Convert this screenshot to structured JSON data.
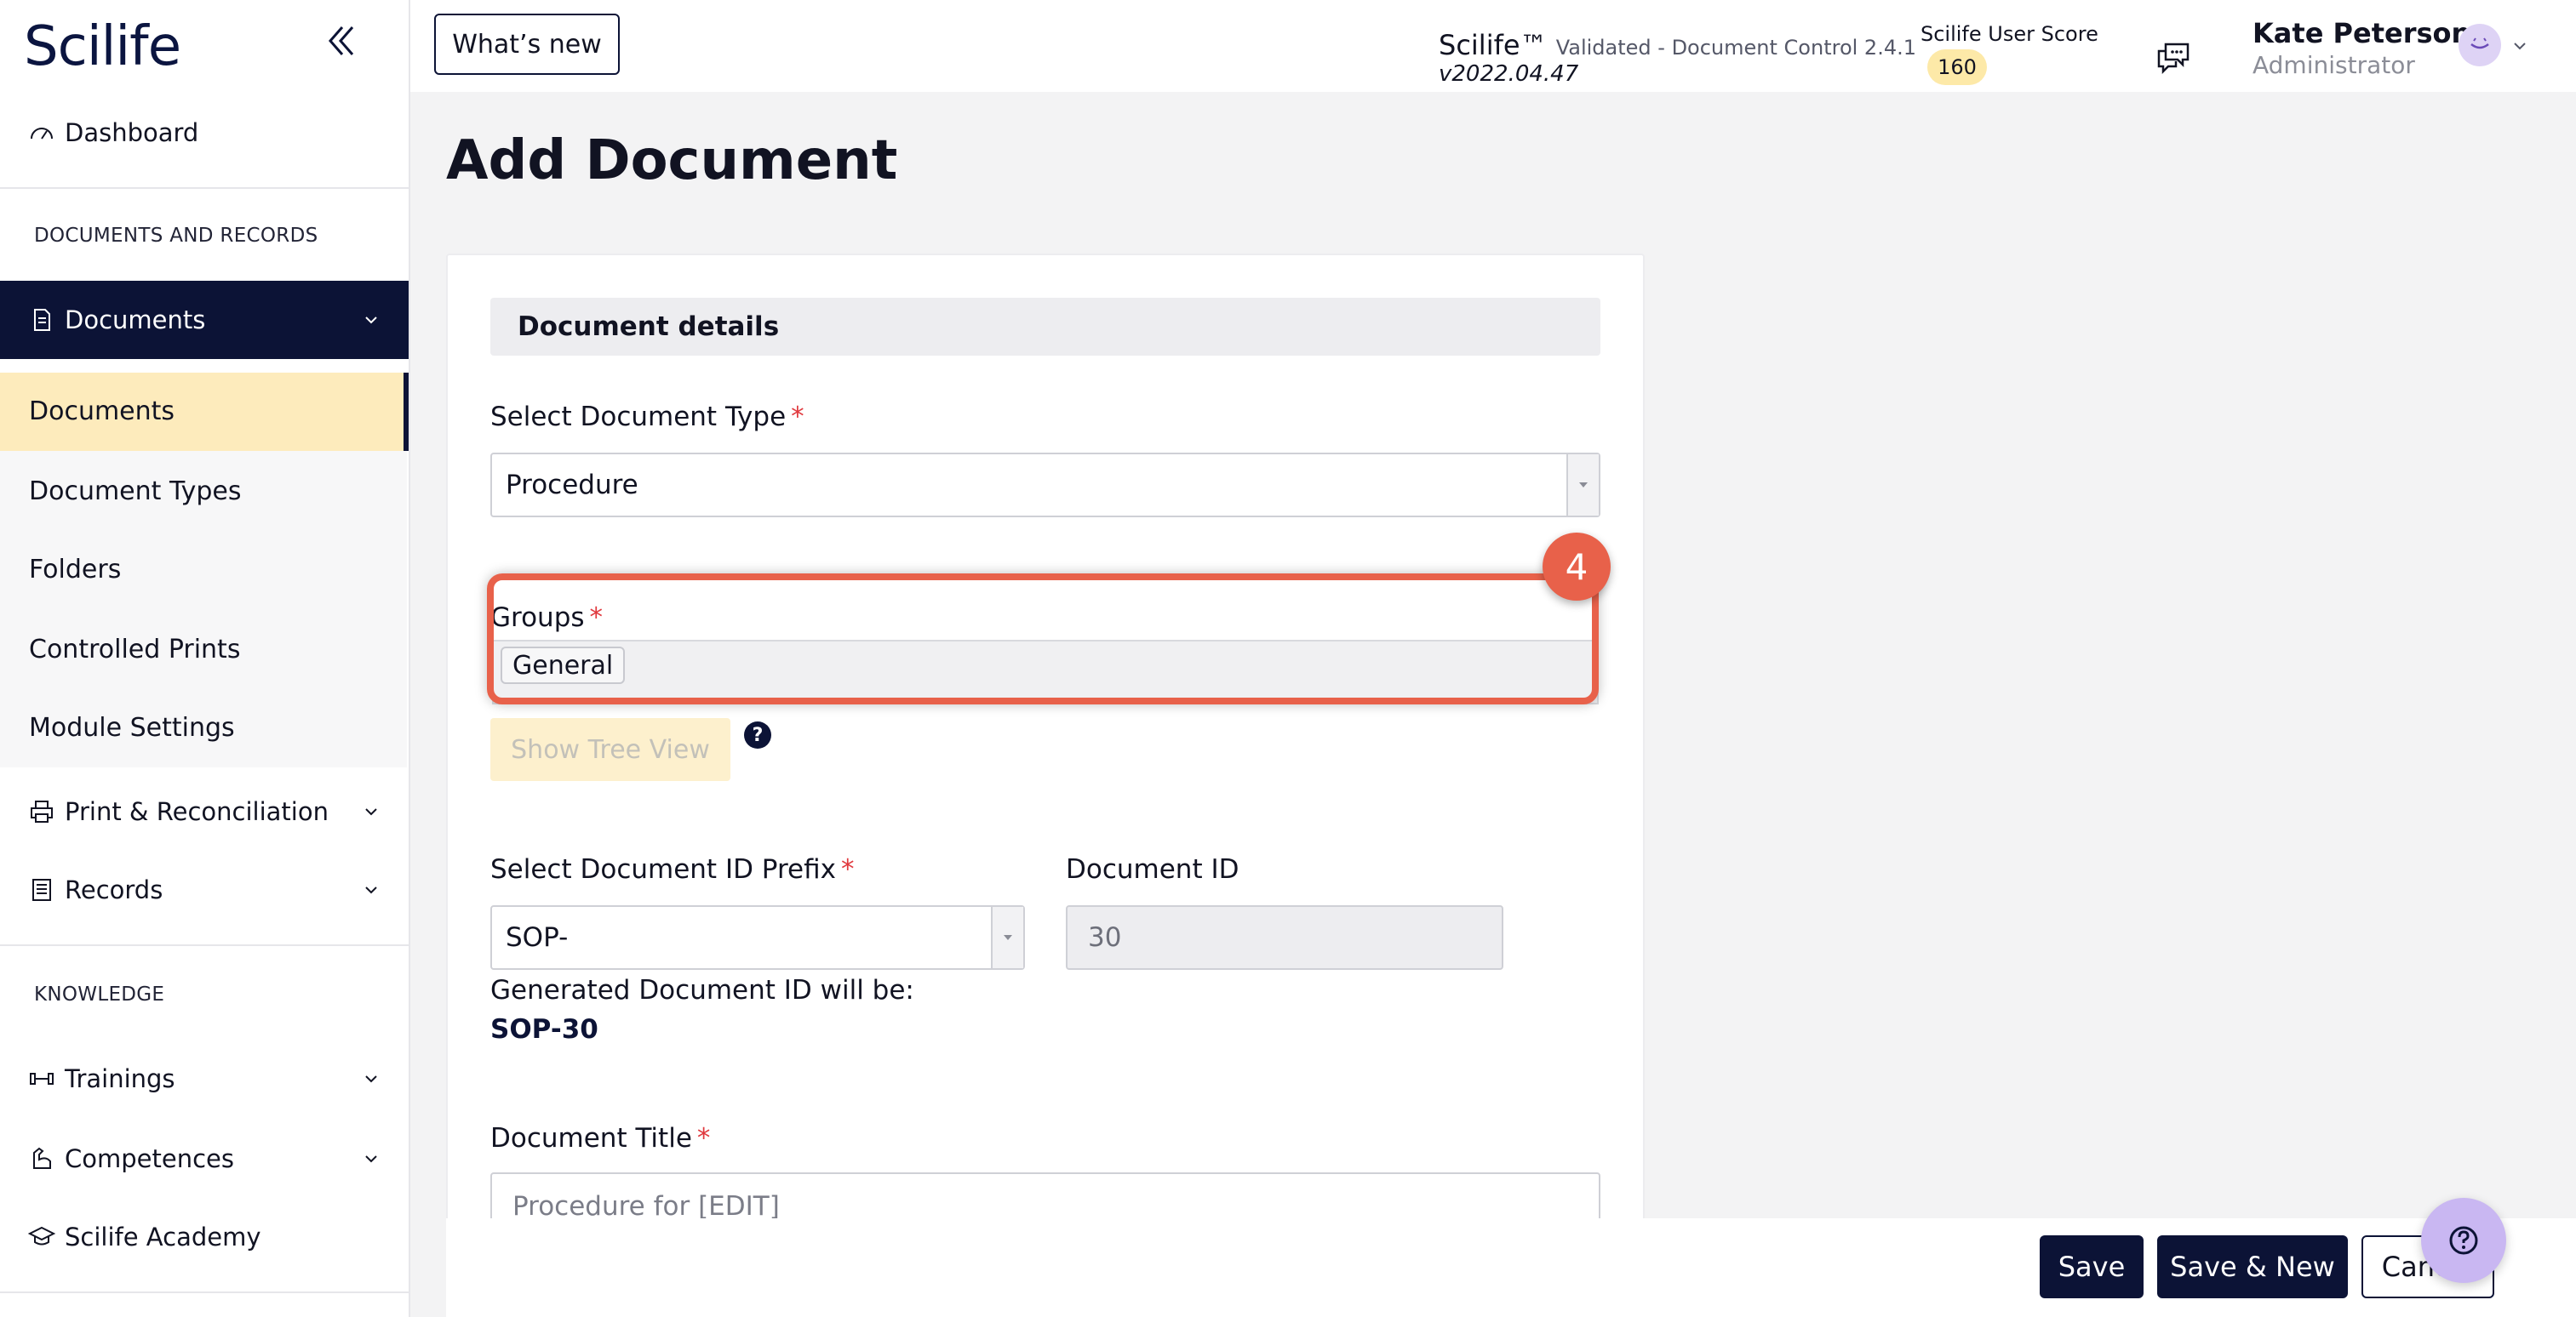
{
  "sidebar": {
    "logo": "Scilife",
    "dashboard": "Dashboard",
    "section_documents": "DOCUMENTS AND RECORDS",
    "documents_group": "Documents",
    "sub_items": [
      "Documents",
      "Document Types",
      "Folders",
      "Controlled Prints",
      "Module Settings"
    ],
    "print_reconciliation": "Print & Reconciliation",
    "records": "Records",
    "section_knowledge": "KNOWLEDGE",
    "trainings": "Trainings",
    "competences": "Competences",
    "academy": "Scilife Academy"
  },
  "topbar": {
    "whats_new": "What’s new",
    "app_name": "Scilife™",
    "app_sub": "Validated - Document Control 2.4.1",
    "app_version": "v2022.04.47",
    "score_label": "Scilife User Score",
    "score_value": "160",
    "user_name": "Kate Peterson",
    "user_role": "Administrator"
  },
  "main": {
    "title": "Add Document",
    "section_title": "Document details",
    "doc_type_label": "Select Document Type",
    "doc_type_value": "Procedure",
    "groups_label": "Groups",
    "groups_tag": "General",
    "step_number": "4",
    "tree_button": "Show Tree View",
    "prefix_label": "Select Document ID Prefix",
    "prefix_value": "SOP-",
    "doc_id_label": "Document ID",
    "doc_id_value": "30",
    "generated_label": "Generated Document ID will be:",
    "generated_value": "SOP-30",
    "title_label": "Document Title",
    "title_placeholder": "Procedure for [EDIT]",
    "required_mark": "*"
  },
  "footer": {
    "save": "Save",
    "save_new": "Save & New",
    "cancel": "Cancel"
  },
  "colors": {
    "navy": "#0c1336",
    "highlight": "#e8614a",
    "active_bg": "#fdebbc"
  }
}
